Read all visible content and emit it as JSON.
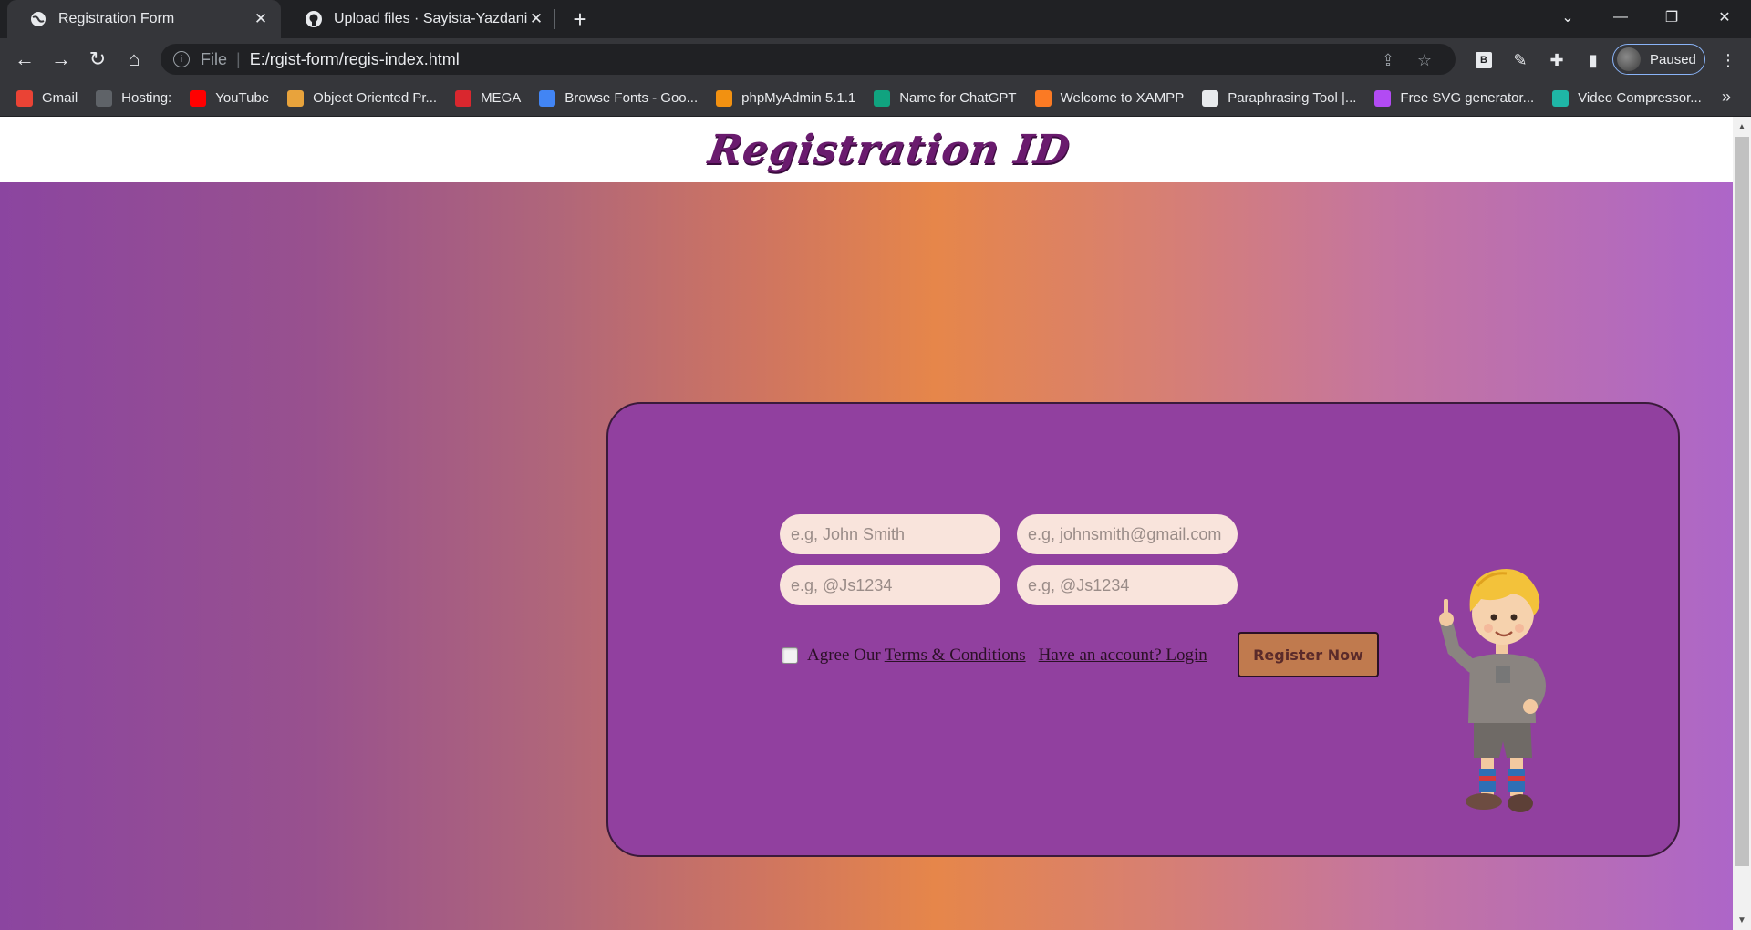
{
  "browser": {
    "tabs": [
      {
        "title": "Registration Form",
        "icon": "globe-icon"
      },
      {
        "title": "Upload files · Sayista-Yazdani/Re",
        "icon": "github-icon"
      }
    ],
    "address": {
      "protocol": "File",
      "url": "E:/rgist-form/regis-index.html"
    },
    "profile_label": "Paused",
    "bookmarks": [
      {
        "label": "Gmail",
        "icon": "gmail-icon",
        "color": "#ea4335"
      },
      {
        "label": "Hosting:",
        "icon": "globe-icon",
        "color": "#5f6368"
      },
      {
        "label": "YouTube",
        "icon": "youtube-icon",
        "color": "#ff0000"
      },
      {
        "label": "Object Oriented Pr...",
        "icon": "book-icon",
        "color": "#e8a33c"
      },
      {
        "label": "MEGA",
        "icon": "mega-icon",
        "color": "#d9272e"
      },
      {
        "label": "Browse Fonts - Goo...",
        "icon": "fonts-icon",
        "color": "#4285f4"
      },
      {
        "label": "phpMyAdmin 5.1.1",
        "icon": "phpmyadmin-icon",
        "color": "#f29111"
      },
      {
        "label": "Name for ChatGPT",
        "icon": "chatgpt-icon",
        "color": "#10a37f"
      },
      {
        "label": "Welcome to XAMPP",
        "icon": "xampp-icon",
        "color": "#fb7a24"
      },
      {
        "label": "Paraphrasing Tool |...",
        "icon": "quill-icon",
        "color": "#e8eaed"
      },
      {
        "label": "Free SVG generator...",
        "icon": "svg-icon",
        "color": "#b24bf3"
      },
      {
        "label": "Video Compressor...",
        "icon": "play-icon",
        "color": "#1fb6a6"
      }
    ]
  },
  "page": {
    "brand": "Registration ID",
    "form": {
      "name_placeholder": "e.g, John Smith",
      "email_placeholder": "e.g, johnsmith@gmail.com",
      "password_placeholder": "e.g, @Js1234",
      "confirm_placeholder": "e.g, @Js1234",
      "agree_text": "Agree Our",
      "terms_link": "Terms & Conditions",
      "login_link": "Have an account? Login",
      "register_button": "Register Now"
    }
  }
}
